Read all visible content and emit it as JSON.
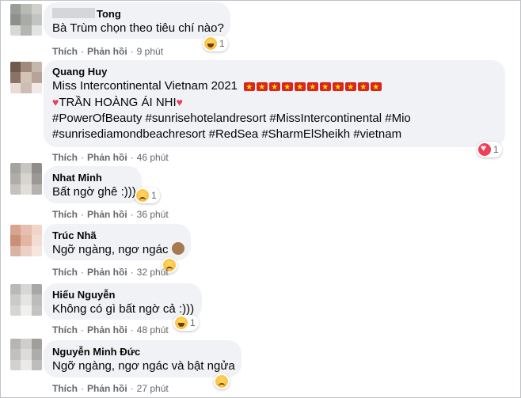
{
  "comments": [
    {
      "author": "Tong",
      "lines": [
        "Bà Trùm chọn theo tiêu chí nào?"
      ],
      "like": "Thích",
      "reply": "Phản hồi",
      "time": "9 phút",
      "reaction": {
        "type": "haha-icon",
        "count": "1"
      }
    },
    {
      "author": "Quang Huy",
      "lines": [
        "Miss Intercontinental Vietnam 2021",
        "TRẦN HOÀNG ÁI NHI",
        "#PowerOfBeauty #sunrisehotelandresort #MissIntercontinental #Mio",
        "#sunrisediamondbeachresort #RedSea #SharmElSheikh #vietnam"
      ],
      "like": "Thích",
      "reply": "Phản hồi",
      "time": "46 phút",
      "reaction": {
        "type": "love-icon",
        "count": "1"
      }
    },
    {
      "author": "Nhat Minh",
      "lines": [
        "Bất ngờ ghê :)))"
      ],
      "like": "Thích",
      "reply": "Phản hồi",
      "time": "36 phút",
      "reaction": {
        "type": "sad-icon",
        "count": "1"
      }
    },
    {
      "author": "Trúc Nhã",
      "lines": [
        "Ngỡ ngàng, ngơ ngác"
      ],
      "like": "Thích",
      "reply": "Phản hồi",
      "time": "32 phút",
      "reaction": {
        "type": "sad-icon",
        "count": ""
      }
    },
    {
      "author": "Hiếu Nguyễn",
      "lines": [
        "Không có gì bất ngờ cả :)))"
      ],
      "like": "Thích",
      "reply": "Phản hồi",
      "time": "48 phút",
      "reaction": {
        "type": "haha-icon",
        "count": "1"
      }
    },
    {
      "author": "Nguyễn Minh Đức",
      "lines": [
        "Ngỡ ngàng, ngơ ngác và bật ngửa"
      ],
      "like": "Thích",
      "reply": "Phản hồi",
      "time": "27 phút",
      "reaction": {
        "type": "sad-icon",
        "count": ""
      }
    }
  ]
}
